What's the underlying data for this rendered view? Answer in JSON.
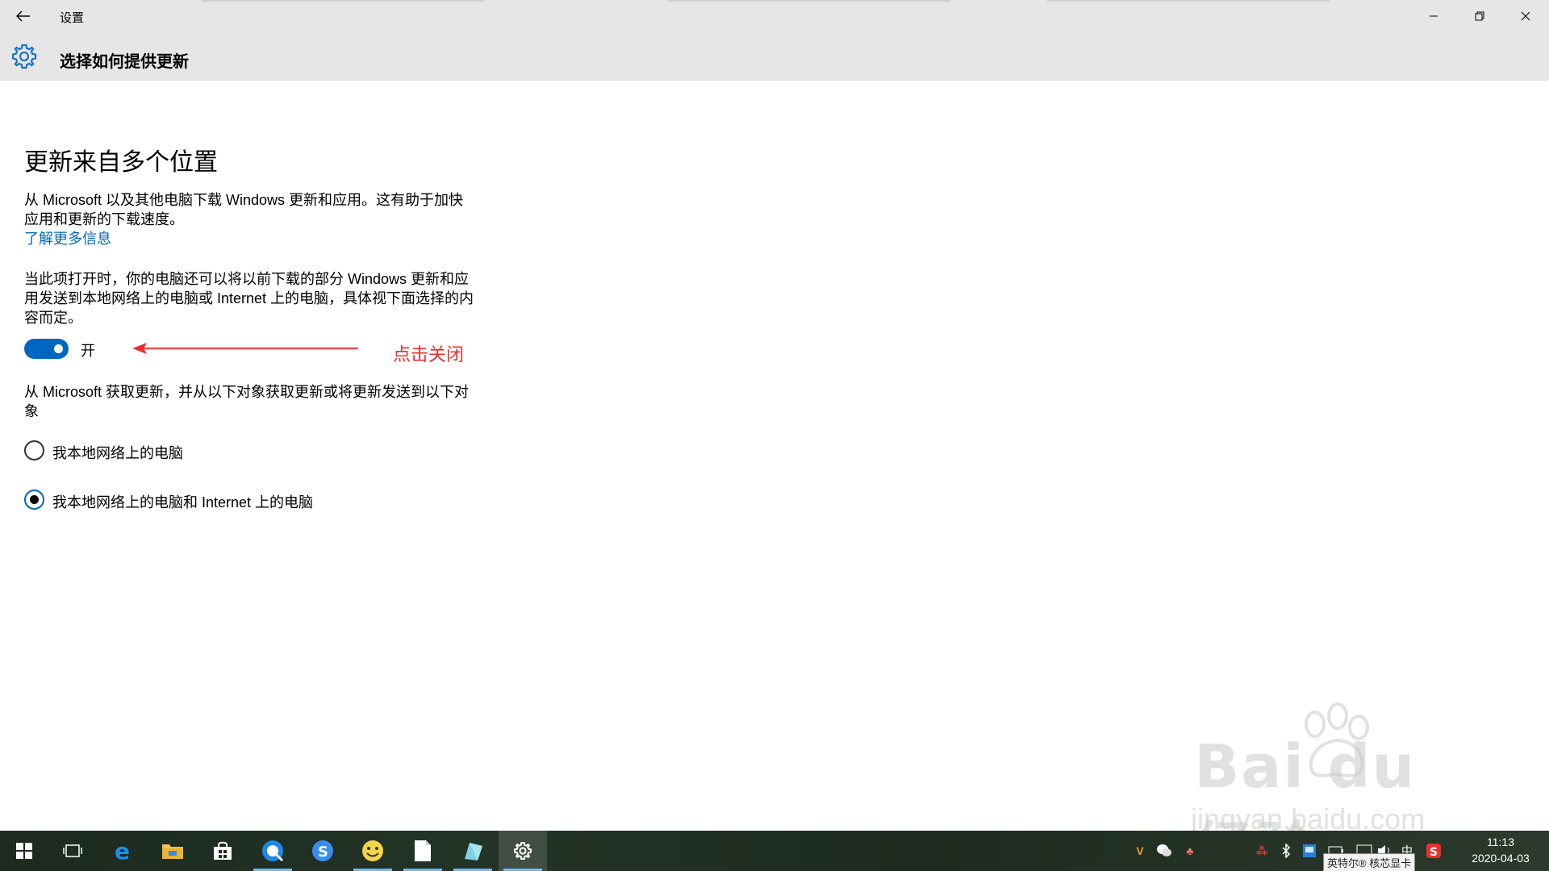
{
  "window": {
    "title": "设置",
    "back_icon": "back-arrow-icon",
    "minimize_icon": "minimize-icon",
    "maximize_icon": "restore-icon",
    "close_icon": "close-icon"
  },
  "header": {
    "icon": "gear-icon",
    "title": "选择如何提供更新"
  },
  "content": {
    "section_title": "更新来自多个位置",
    "description": "从 Microsoft 以及其他电脑下载 Windows 更新和应用。这有助于加快应用和更新的下载速度。",
    "learn_more": "了解更多信息",
    "toggle_description": "当此项打开时，你的电脑还可以将以前下载的部分 Windows 更新和应用发送到本地网络上的电脑或 Internet 上的电脑，具体视下面选择的内容而定。",
    "toggle": {
      "state": "on",
      "label": "开"
    },
    "annotation": "点击关闭",
    "radio_intro": "从 Microsoft 获取更新，并从以下对象获取更新或将更新发送到以下对象",
    "options": [
      {
        "label": "我本地网络上的电脑",
        "selected": false
      },
      {
        "label": "我本地网络上的电脑和 Internet 上的电脑",
        "selected": true
      }
    ]
  },
  "watermark": {
    "brand": "Bai du 经验",
    "url": "jingyan.baidu.com"
  },
  "taskbar": {
    "pinned": [
      "start-icon",
      "task-view-icon",
      "edge-icon",
      "file-explorer-icon",
      "store-icon",
      "browser-icon",
      "sogou-icon",
      "emoji-app-icon",
      "notepad-icon",
      "paint-icon",
      "settings-icon"
    ],
    "tray_tooltip": "英特尔® 核芯显卡",
    "ime": "中",
    "time": "11:13",
    "date": "2020-04-03"
  },
  "colors": {
    "accent": "#0067c0",
    "link": "#0067b8",
    "annotation": "#e8302e"
  }
}
